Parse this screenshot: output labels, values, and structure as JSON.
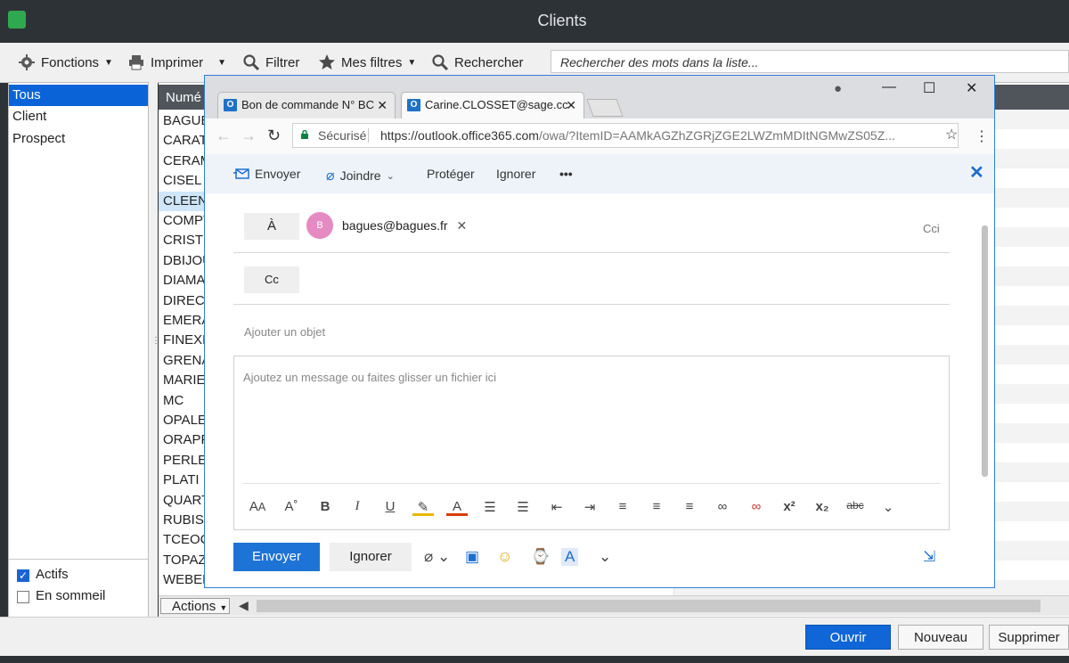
{
  "window": {
    "title": "Clients"
  },
  "toolbar": {
    "fonctions": "Fonctions",
    "imprimer": "Imprimer",
    "filtrer": "Filtrer",
    "mes_filtres": "Mes filtres",
    "rechercher": "Rechercher",
    "search_placeholder": "Rechercher des mots dans la liste..."
  },
  "left_panel": {
    "items": [
      "Tous",
      "Client",
      "Prospect"
    ],
    "checkboxes": [
      {
        "label": "Actifs",
        "checked": true
      },
      {
        "label": "En sommeil",
        "checked": false
      }
    ]
  },
  "list": {
    "column_header": "Numé",
    "rows": [
      "BAGUE",
      "CARAT",
      "CERAM",
      "CISEL",
      "CLEEN",
      "COMPT",
      "CRIST",
      "DBIJOU",
      "DIAMA",
      "DIRECT",
      "EMERA",
      "FINEXK",
      "GRENA",
      "MARIE",
      "MC",
      "OPALE",
      "ORAPP",
      "PERLE",
      "PLATI",
      "QUART",
      "RUBIS",
      "TCEOC",
      "TOPAZ",
      "WEBEL"
    ],
    "selected_index": 4,
    "actions_label": "Actions"
  },
  "bottom_buttons": {
    "ouvrir": "Ouvrir",
    "nouveau": "Nouveau",
    "supprimer": "Supprimer"
  },
  "browser": {
    "tabs": [
      {
        "title": "Bon de commande N° BC"
      },
      {
        "title": "Carine.CLOSSET@sage.cc"
      }
    ],
    "secure_label": "Sécurisé",
    "url_main": "https://outlook.office365.com",
    "url_rest": "/owa/?ItemID=AAMkAGZhZGRjZGE2LWZmMDItNGMwZS05Z..."
  },
  "owa": {
    "commands": {
      "send": "Envoyer",
      "attach": "Joindre",
      "protect": "Protéger",
      "discard": "Ignorer",
      "more": "•••"
    },
    "to_label": "À",
    "recipient_initial": "B",
    "recipient": "bagues@bagues.fr",
    "cci_label": "Cci",
    "cc_label": "Cc",
    "subject_placeholder": "Ajouter un objet",
    "body_placeholder": "Ajoutez un message ou faites glisser un fichier ici",
    "send_button": "Envoyer",
    "discard_button": "Ignorer"
  },
  "icons": {
    "accent": "#1e73d6",
    "selection": "#0a64d8"
  }
}
